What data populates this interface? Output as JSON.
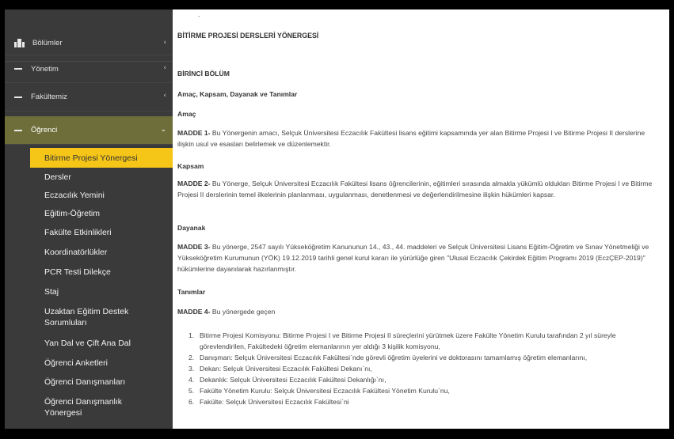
{
  "sidebar": {
    "sections": [
      {
        "label": "Bölümler",
        "icon": "building-icon"
      },
      {
        "label": "Yönetim",
        "icon": "dash-icon"
      },
      {
        "label": "Fakültemiz",
        "icon": "dash-icon"
      }
    ],
    "open_group": {
      "label": "Öğrenci",
      "icon": "dash-icon"
    },
    "items": [
      "Bitirme Projesi Yönergesi",
      "Dersler",
      "Eczacılık Yemini",
      "Eğitim-Öğretim",
      "Fakülte Etkinlikleri",
      "Koordinatörlükler",
      "PCR Testi Dilekçe",
      "Staj",
      "Uzaktan Eğitim Destek Sorumluları",
      "Yan Dal ve Çift Ana Dal",
      "Öğrenci Anketleri",
      "Öğrenci Danışmanları",
      "Öğrenci Danışmanlık Yönergesi"
    ],
    "active_index": 0,
    "colors": {
      "background": "#3a3a3a",
      "group": "#6e6e3a",
      "active": "#f5c518"
    }
  },
  "doc": {
    "title": "BİTİRME PROJESİ DERSLERİ YÖNERGESİ",
    "chapter": "BİRİNCİ BÖLÜM",
    "chapter_subtitle": "Amaç, Kapsam, Dayanak ve Tanımlar",
    "s1_heading": "Amaç",
    "m1_label": "MADDE 1-",
    "m1_text": " Bu Yönergenin amacı, Selçuk Üniversitesi Eczacılık Fakültesi lisans eğitimi kapsamında yer alan Bitirme Projesi I ve Bitirme Projesi II derslerine ilişkin usul ve esasları belirlemek ve düzenlemektir.",
    "s2_heading": "Kapsam",
    "m2_label": "MADDE 2-",
    "m2_text": " Bu Yönerge, Selçuk Üniversitesi Eczacılık Fakültesi lisans öğrencilerinin, eğitimleri sırasında almakla yükümlü oldukları Bitirme Projesi I ve Bitirme Projesi II derslerinin temel ilkelerinin planlanması, uygulanması, denetlenmesi ve değerlendirilmesine ilişkin hükümleri kapsar.",
    "s3_heading": "Dayanak",
    "m3_label": "MADDE 3-",
    "m3_text": " Bu yönerge, 2547 sayılı Yükseköğretim Kanununun 14., 43., 44. maddeleri ve Selçuk Üniversitesi Lisans Eğitim-Öğretim ve Sınav Yönetmeliği ve Yükseköğretim Kurumunun (YÖK) 19.12.2019 tarihli genel kurul kararı ile yürürlüğe giren \"Ulusal Eczacılık Çekirdek Eğitim Programı 2019 (EczÇEP-2019)\" hükümlerine dayanılarak hazırlanmıştır.",
    "s4_heading": "Tanımlar",
    "m4_label": "MADDE 4-",
    "m4_text": " Bu yönergede geçen",
    "definitions": [
      {
        "n": "1.",
        "text": "Bitirme Projesi Komisyonu: Bitirme Projesi I ve Bitirme Projesi II süreçlerini yürütmek üzere Fakülte Yönetim Kurulu tarafından 2 yıl süreyle görevlendirilen, Fakültedeki öğretim elemanlarının yer aldığı 3 kişilik komisyonu,"
      },
      {
        "n": "2.",
        "text": "Danışman: Selçuk Üniversitesi Eczacılık Fakültesi`nde görevli öğretim üyelerini ve doktorasını tamamlamış öğretim elemanlarını,"
      },
      {
        "n": "3.",
        "text": "Dekan: Selçuk Üniversitesi Eczacılık Fakültesi Dekanı`nı,"
      },
      {
        "n": "4.",
        "text": "Dekanlık: Selçuk Üniversitesi Eczacılık Fakültesi Dekanlığı`nı,"
      },
      {
        "n": "5.",
        "text": "Fakülte Yönetim Kurulu: Selçuk Üniversitesi Eczacılık Fakültesi Yönetim Kurulu`nu,"
      },
      {
        "n": "6.",
        "text": "Fakülte: Selçuk Üniversitesi Eczacılık Fakültesi`ni"
      }
    ]
  }
}
